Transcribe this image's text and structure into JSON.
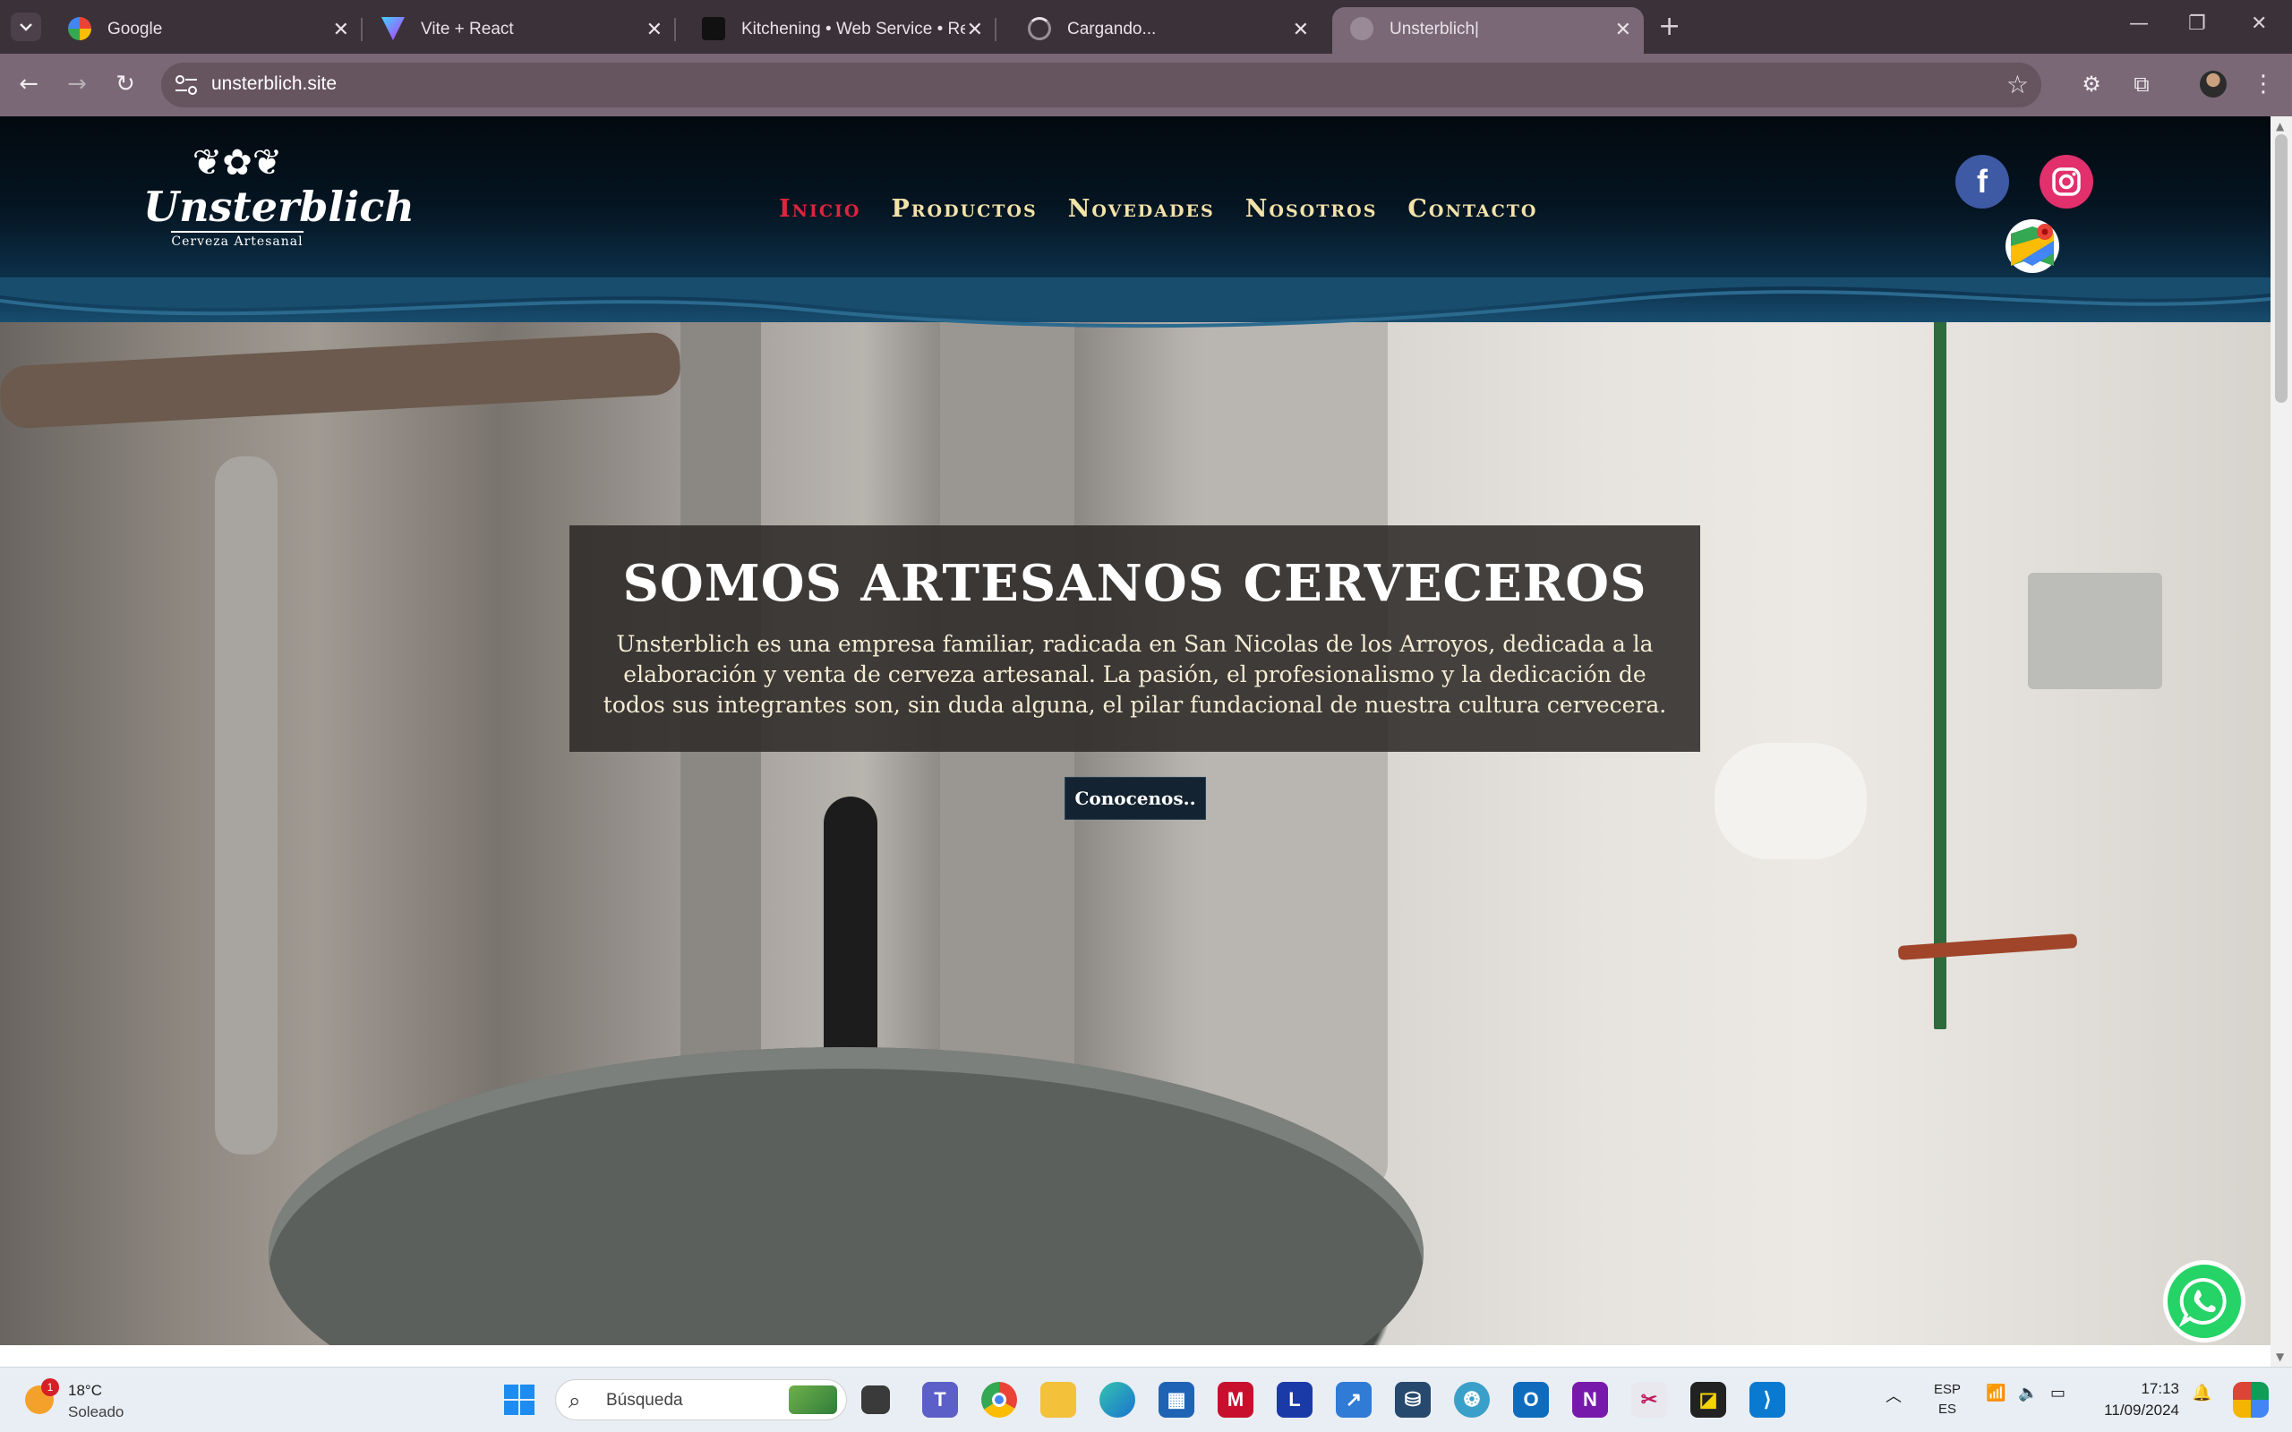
{
  "browser": {
    "tabs": [
      {
        "title": "Google",
        "icon": "google-icon"
      },
      {
        "title": "Vite + React",
        "icon": "vite-icon"
      },
      {
        "title": "Kitchening • Web Service • Ren",
        "icon": "render-icon"
      },
      {
        "title": "Cargando...",
        "icon": "loading-icon"
      },
      {
        "title": "Unsterblich|",
        "icon": "globe-icon",
        "active": true
      }
    ],
    "url": "unsterblich.site"
  },
  "site": {
    "logo": {
      "brand": "Unsterblich",
      "tagline": "Cerveza Artesanal"
    },
    "nav": [
      {
        "label": "Inicio",
        "active": true
      },
      {
        "label": "Productos"
      },
      {
        "label": "Novedades"
      },
      {
        "label": "Nosotros"
      },
      {
        "label": "Contacto"
      }
    ],
    "social": {
      "facebook": "f"
    },
    "hero": {
      "title": "SOMOS ARTESANOS CERVECEROS",
      "description": "Unsterblich es una empresa familiar, radicada en San Nicolas de los Arroyos, dedicada a la elaboración y venta de cerveza artesanal. La pasión, el profesionalismo y la dedicación de todos sus integrantes son, sin duda alguna, el pilar fundacional de nuestra cultura cervecera.",
      "cta": "Conocenos.."
    },
    "colors": {
      "nav_text": "#f3e3a9",
      "nav_active": "#e0243c",
      "header_dark": "#03090f",
      "cta_bg": "#132331"
    }
  },
  "taskbar": {
    "weather": {
      "badge": "1",
      "temp": "18°C",
      "condition": "Soleado"
    },
    "search_placeholder": "Búsqueda",
    "language": {
      "line1": "ESP",
      "line2": "ES"
    },
    "clock": {
      "time": "17:13",
      "date": "11/09/2024"
    },
    "pinned_apps": [
      "windows-start-icon",
      "search",
      "task-view-icon",
      "teams-icon",
      "chrome-icon",
      "file-explorer-icon",
      "edge-icon",
      "store-icon",
      "mcafee-icon",
      "l-app-icon",
      "azure-data-studio-icon",
      "sql-icon",
      "network-icon",
      "outlook-icon",
      "onenote-icon",
      "snipping-tool-icon",
      "sticky-notes-icon",
      "vscode-icon"
    ]
  }
}
